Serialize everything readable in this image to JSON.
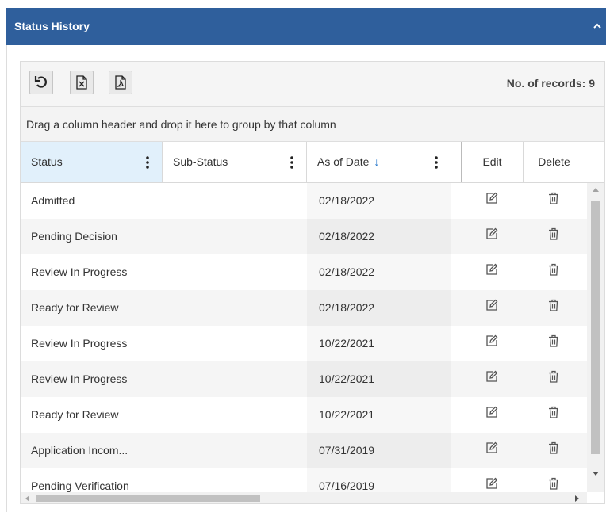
{
  "panel": {
    "title": "Status History",
    "collapse_icon": "chevron-up-icon"
  },
  "toolbar": {
    "buttons": [
      {
        "icon": "undo-icon"
      },
      {
        "icon": "excel-export-icon"
      },
      {
        "icon": "pdf-export-icon"
      }
    ],
    "records_label": "No. of records: 9"
  },
  "group_bar": {
    "text": "Drag a column header and drop it here to group by that column"
  },
  "columns": [
    {
      "label": "Status"
    },
    {
      "label": "Sub-Status"
    },
    {
      "label": "As of Date",
      "sort": "descending"
    },
    {
      "label": "Edit"
    },
    {
      "label": "Delete"
    }
  ],
  "rows": [
    {
      "status": "Admitted",
      "sub_status": "",
      "as_of_date": "02/18/2022"
    },
    {
      "status": "Pending Decision",
      "sub_status": "",
      "as_of_date": "02/18/2022"
    },
    {
      "status": "Review In Progress",
      "sub_status": "",
      "as_of_date": "02/18/2022"
    },
    {
      "status": "Ready for Review",
      "sub_status": "",
      "as_of_date": "02/18/2022"
    },
    {
      "status": "Review In Progress",
      "sub_status": "",
      "as_of_date": "10/22/2021"
    },
    {
      "status": "Review In Progress",
      "sub_status": "",
      "as_of_date": "10/22/2021"
    },
    {
      "status": "Ready for Review",
      "sub_status": "",
      "as_of_date": "10/22/2021"
    },
    {
      "status": "Application Incom...",
      "sub_status": "",
      "as_of_date": "07/31/2019"
    },
    {
      "status": "Pending Verification",
      "sub_status": "",
      "as_of_date": "07/16/2019"
    }
  ],
  "colors": {
    "header_bg": "#2f5f9c",
    "active_column_bg": "#e1f0fb",
    "sort_arrow": "#1f73c9"
  }
}
